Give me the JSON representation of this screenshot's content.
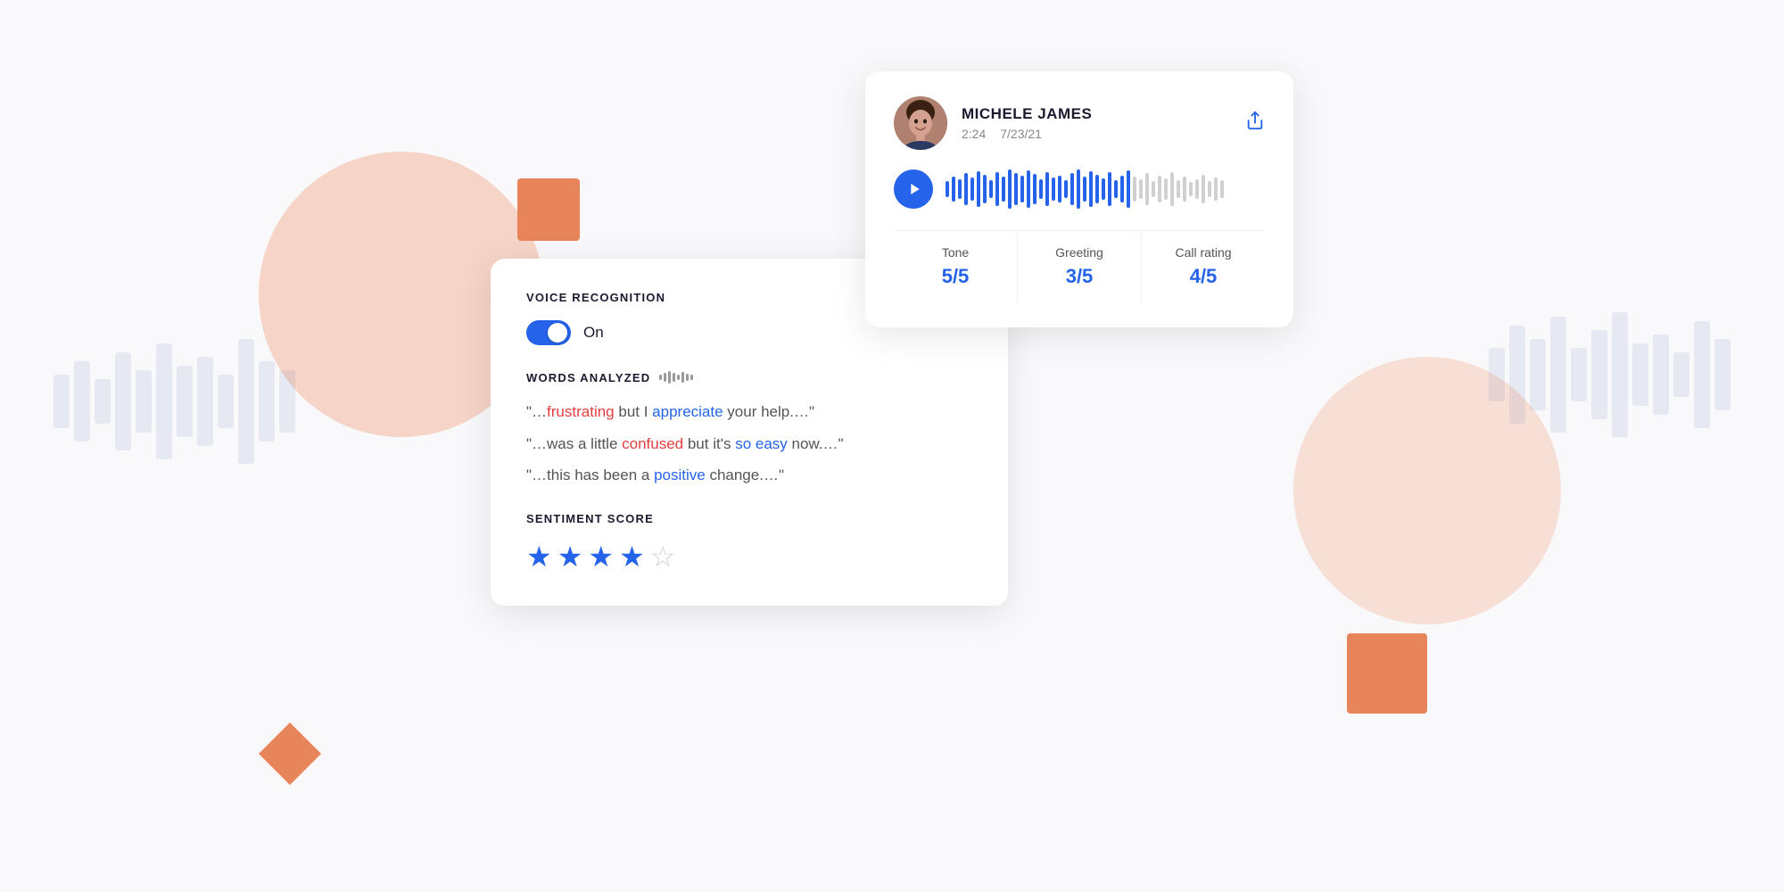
{
  "background": {
    "color": "#f9f9fb"
  },
  "call_card": {
    "caller_name": "MICHELE JAMES",
    "call_duration": "2:24",
    "call_date": "7/23/21",
    "share_icon_label": "share",
    "play_button_label": "play",
    "metrics": [
      {
        "label": "Tone",
        "value": "5/5"
      },
      {
        "label": "Greeting",
        "value": "3/5"
      },
      {
        "label": "Call rating",
        "value": "4/5"
      }
    ]
  },
  "voice_card": {
    "section1_label": "VOICE RECOGNITION",
    "toggle_label": "On",
    "toggle_state": "on",
    "section2_label": "WORDS ANALYZED",
    "quotes": [
      {
        "prefix": "“…",
        "word1": "frustrating",
        "word1_color": "red",
        "middle": " but I ",
        "word2": "appreciate",
        "word2_color": "blue",
        "suffix": " your help.…”"
      },
      {
        "prefix": "“…was a little ",
        "word1": "confused",
        "word1_color": "red",
        "middle": " but it’s ",
        "word2": "so easy",
        "word2_color": "blue",
        "suffix": " now.…”"
      },
      {
        "prefix": "“…this has been a ",
        "word1": "positive",
        "word1_color": "blue",
        "suffix": " change.…”"
      }
    ],
    "sentiment_label": "SENTIMENT SCORE",
    "stars_filled": 4,
    "stars_total": 5
  }
}
